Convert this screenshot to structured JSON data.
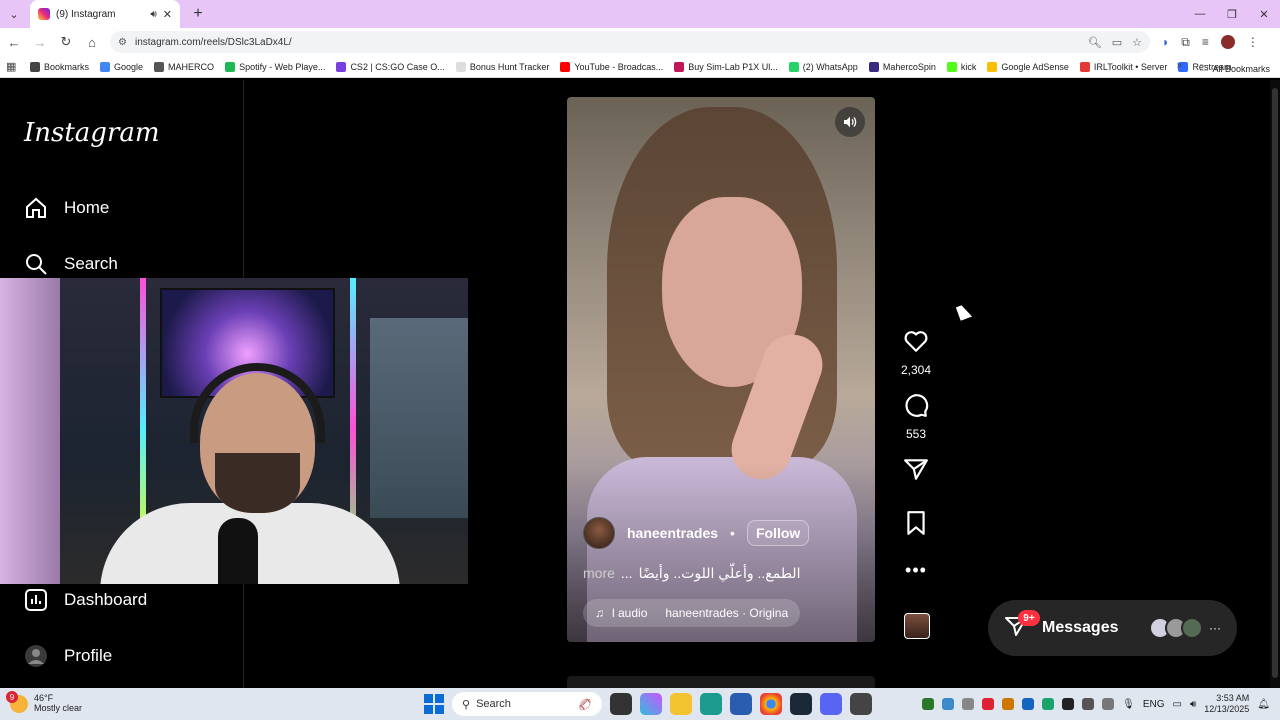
{
  "browser": {
    "tab": {
      "title": "(9) Instagram"
    },
    "url": "instagram.com/reels/DSlc3LaDx4L/",
    "bookmarks": [
      {
        "label": "Bookmarks",
        "color": "#444444"
      },
      {
        "label": "Google",
        "color": "#4285f4"
      },
      {
        "label": "MAHERCO",
        "color": "#555555"
      },
      {
        "label": "Spotify - Web Playe...",
        "color": "#1db954"
      },
      {
        "label": "CS2 | CS:GO Case O...",
        "color": "#7a3fe0"
      },
      {
        "label": "Bonus Hunt Tracker",
        "color": "#dddddd"
      },
      {
        "label": "YouTube - Broadcas...",
        "color": "#ff0000"
      },
      {
        "label": "Buy Sim-Lab P1X Ul...",
        "color": "#c2185b"
      },
      {
        "label": "(2) WhatsApp",
        "color": "#25d366"
      },
      {
        "label": "MahercoSpin",
        "color": "#3b2a80"
      },
      {
        "label": "kick",
        "color": "#53fc18"
      },
      {
        "label": "Google AdSense",
        "color": "#fbbc04"
      },
      {
        "label": "IRLToolkit • Server",
        "color": "#e53935"
      },
      {
        "label": "Restream",
        "color": "#2f6bff"
      }
    ],
    "all_bookmarks": "All Bookmarks"
  },
  "sidebar": {
    "logo": "Instagram",
    "items": [
      {
        "label": "Home",
        "icon": "home-icon"
      },
      {
        "label": "Search",
        "icon": "search-icon"
      },
      {
        "label": "Dashboard",
        "icon": "dashboard-icon"
      },
      {
        "label": "Profile",
        "icon": "profile-icon"
      }
    ]
  },
  "reel": {
    "author": "haneentrades",
    "separator": "•",
    "follow_label": "Follow",
    "caption_more": "more",
    "caption_ellipsis": "...",
    "caption": "الطمع.. وأعلّي اللوت.. وأيضًا",
    "audio_label": "l audio",
    "audio_source": "haneentrades · Origina"
  },
  "actions": {
    "likes": "2,304",
    "comments": "553"
  },
  "messages": {
    "label": "Messages",
    "badge": "9+",
    "more": "···"
  },
  "taskbar": {
    "weather_temp": "46°F",
    "weather_desc": "Mostly clear",
    "weather_badge": "9",
    "search_label": "Search",
    "language": "ENG",
    "time": "3:53 AM",
    "date": "12/13/2025"
  }
}
